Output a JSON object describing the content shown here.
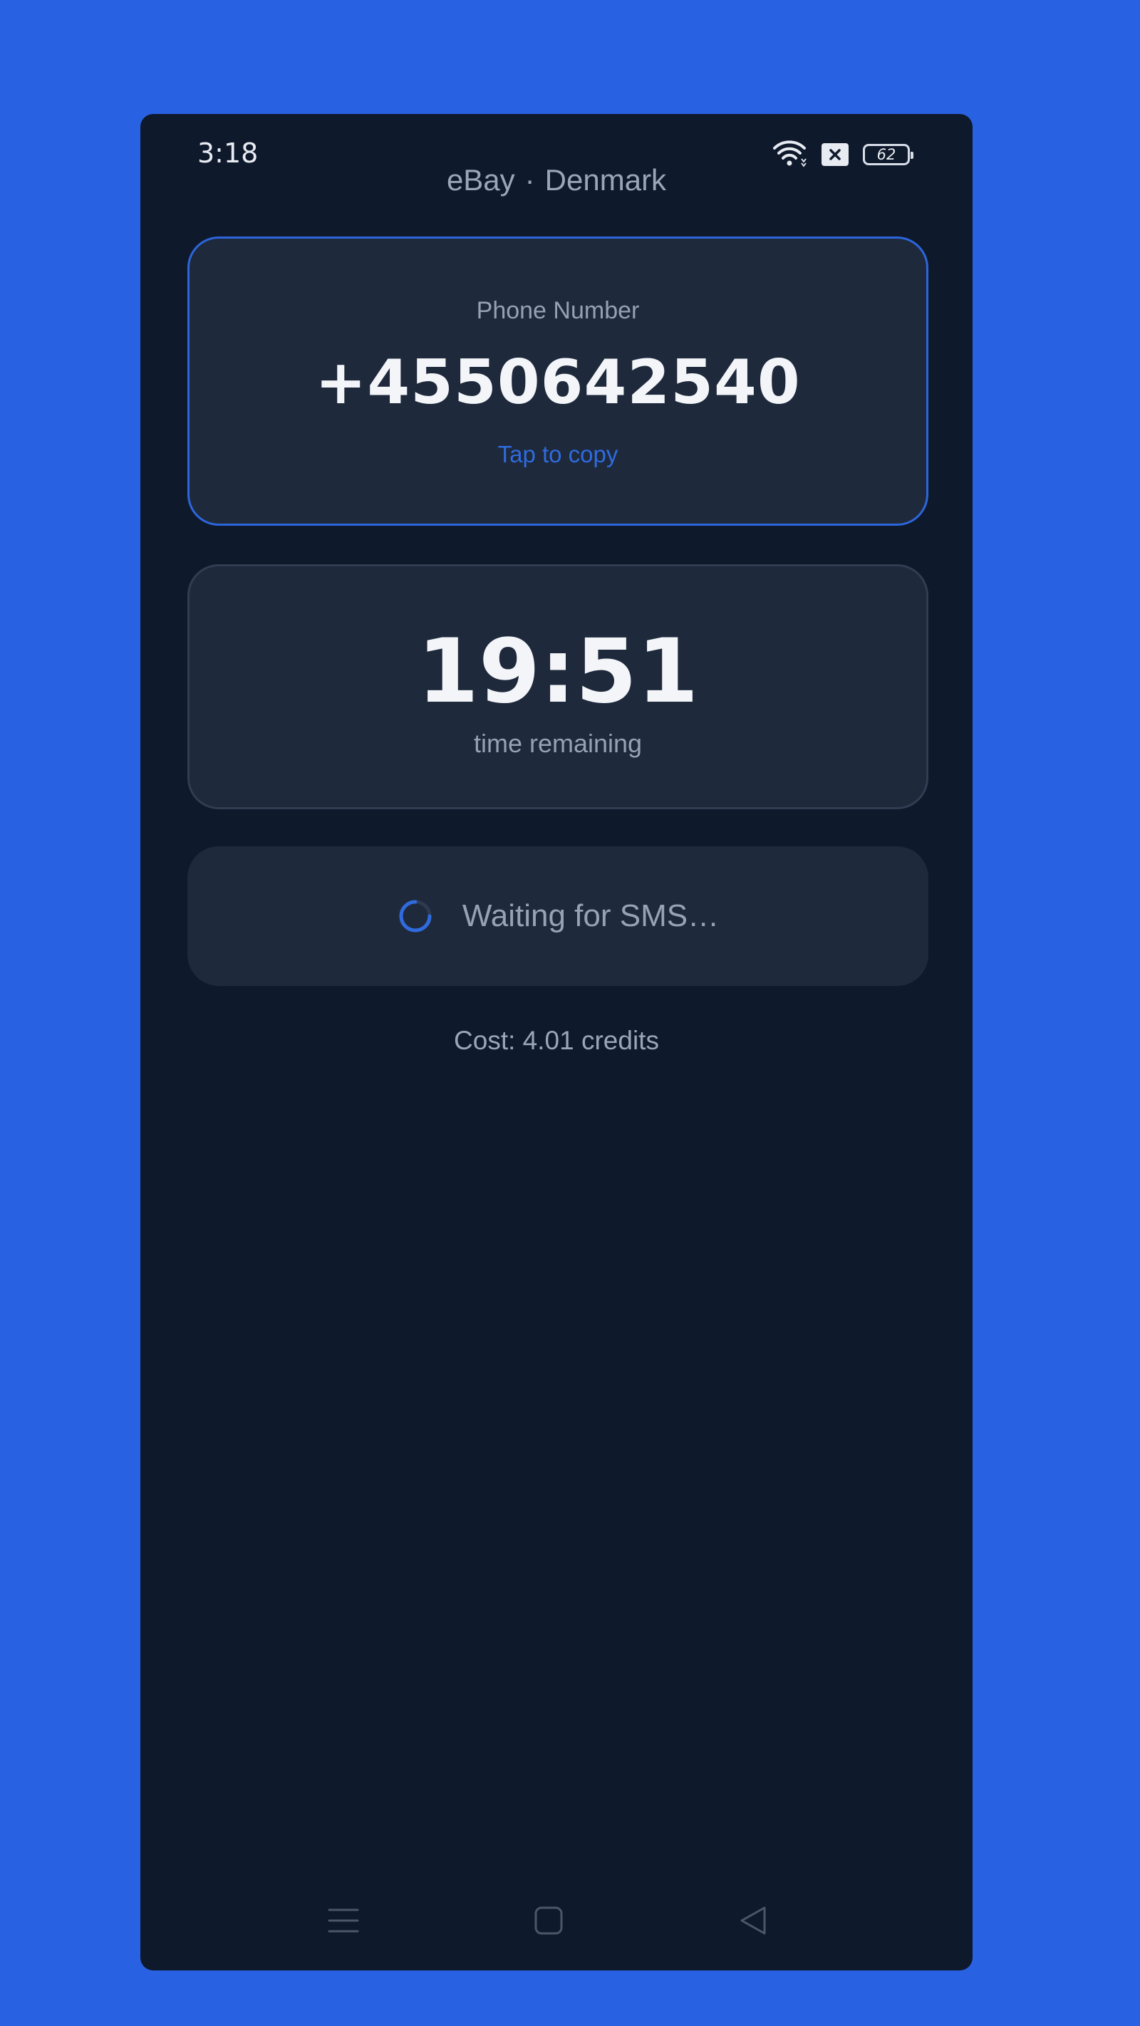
{
  "status_bar": {
    "time": "3:18",
    "battery_level": "62",
    "icons": [
      "wifi-icon",
      "sim-blocked-icon",
      "battery-icon"
    ]
  },
  "header": {
    "service": "eBay",
    "separator": "·",
    "country": "Denmark"
  },
  "phone_card": {
    "label": "Phone Number",
    "number": "+4550642540",
    "copy_hint": "Tap to copy"
  },
  "timer_card": {
    "value": "19:51",
    "label": "time remaining"
  },
  "sms_status": {
    "text": "Waiting for SMS…",
    "icon": "loading-spinner-icon"
  },
  "cost": {
    "text": "Cost: 4.01 credits"
  },
  "nav_bar": {
    "icons": [
      "menu-icon",
      "home-icon",
      "back-icon"
    ]
  },
  "colors": {
    "background": "#2862e3",
    "app_background": "#0f192c",
    "card_background": "#1e293b",
    "accent": "#2d66dc",
    "text_primary": "#f3f5f9",
    "text_secondary": "#95a1b4"
  }
}
